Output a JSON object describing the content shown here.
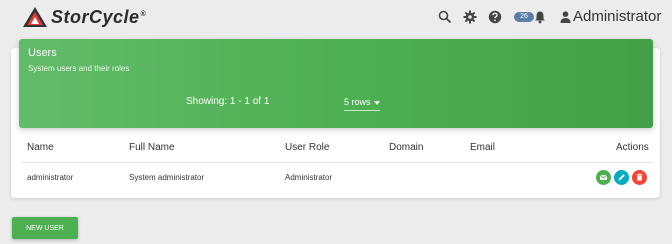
{
  "app": {
    "logo_text": "StorCycle",
    "logo_reg": "®"
  },
  "header": {
    "notifications_count": "26",
    "user_name": "Administrator"
  },
  "panel": {
    "title": "Users",
    "subtitle": "System users and their roles",
    "showing": "Showing: 1 - 1 of 1",
    "rows_select": "5 rows"
  },
  "table": {
    "columns": [
      "Name",
      "Full Name",
      "User Role",
      "Domain",
      "Email",
      "Actions"
    ],
    "rows": [
      {
        "name": "administrator",
        "full_name": "System administrator",
        "role": "Administrator",
        "domain": "",
        "email": ""
      }
    ]
  },
  "actions": {
    "new_user": "NEW USER"
  },
  "colors": {
    "primary_green": "#4caf50",
    "badge_blue": "#5b7ea8",
    "action_email": "#4caf50",
    "action_edit": "#00acc1",
    "action_delete": "#f44336"
  }
}
